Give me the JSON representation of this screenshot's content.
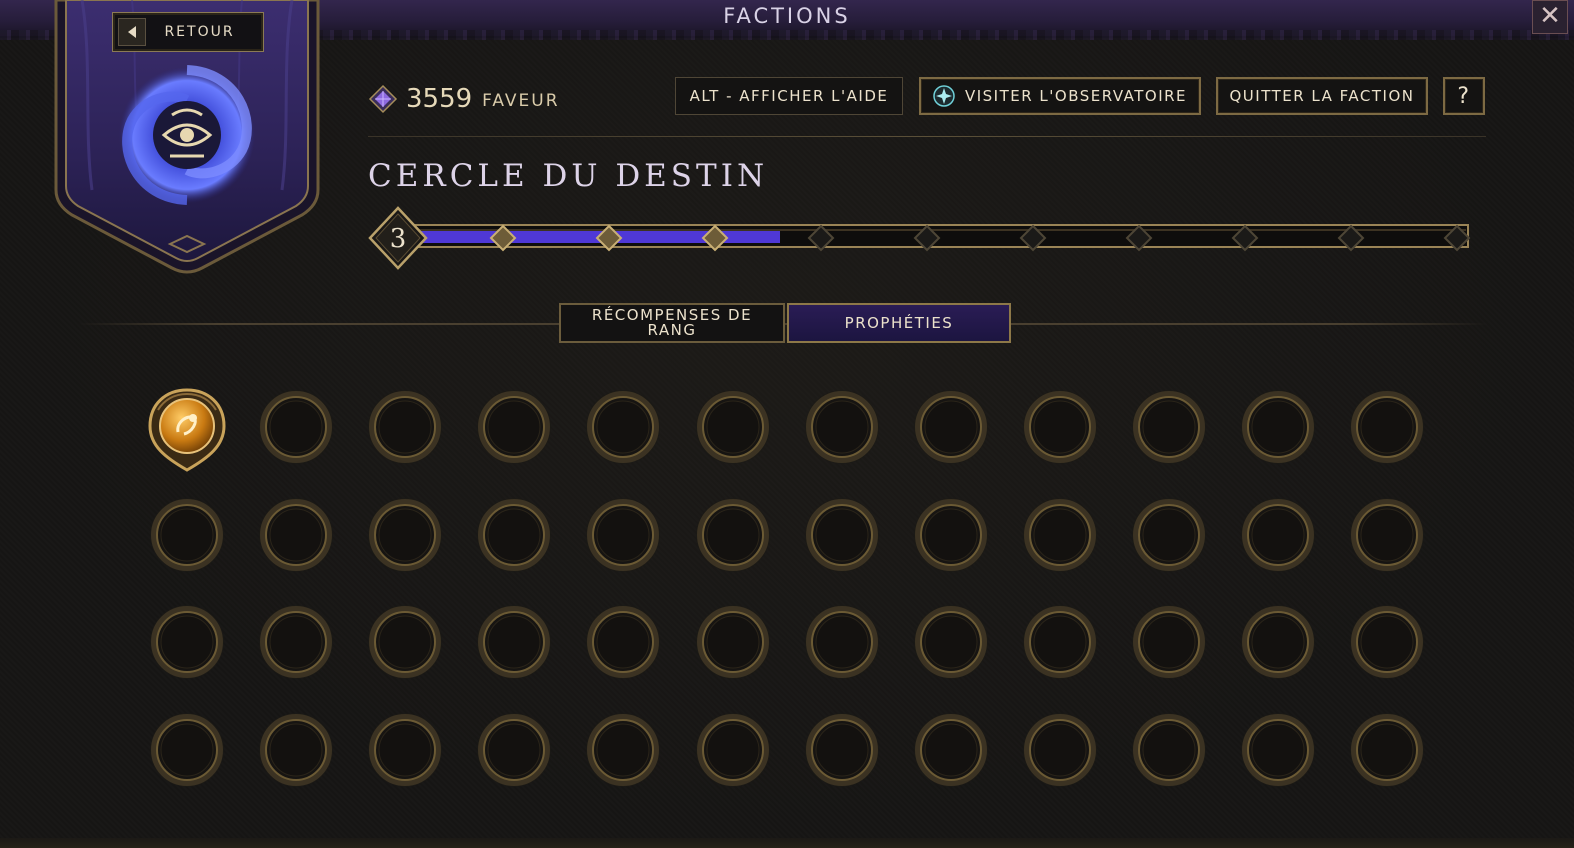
{
  "header": {
    "title": "FACTIONS",
    "close_icon": "close-icon"
  },
  "banner": {
    "back_label": "RETOUR",
    "emblem_icon": "eye-vortex-emblem-icon",
    "color": "#3b2d72"
  },
  "favor": {
    "value": "3559",
    "label": "FAVEUR",
    "icon": "favor-gem-icon"
  },
  "toolbar": {
    "help_hint_label": "ALT - AFFICHER L'AIDE",
    "observatory_label": "VISITER L'OBSERVATOIRE",
    "observatory_icon": "compass-star-icon",
    "leave_label": "QUITTER LA FACTION",
    "help_label": "?"
  },
  "faction": {
    "name": "CERCLE DU DESTIN",
    "rank": "3",
    "rank_total_markers": 10,
    "progress_fraction": 0.35,
    "accent": "#5a3ee0"
  },
  "tabs": [
    {
      "label": "RÉCOMPENSES DE RANG",
      "active": false
    },
    {
      "label": "PROPHÉTIES",
      "active": true
    }
  ],
  "prophecies": {
    "rows": 4,
    "cols": 12,
    "filled_count": 1,
    "filled_icon": "golden-orb-prophecy-icon",
    "empty_icon": "empty-slot-ring-icon"
  }
}
